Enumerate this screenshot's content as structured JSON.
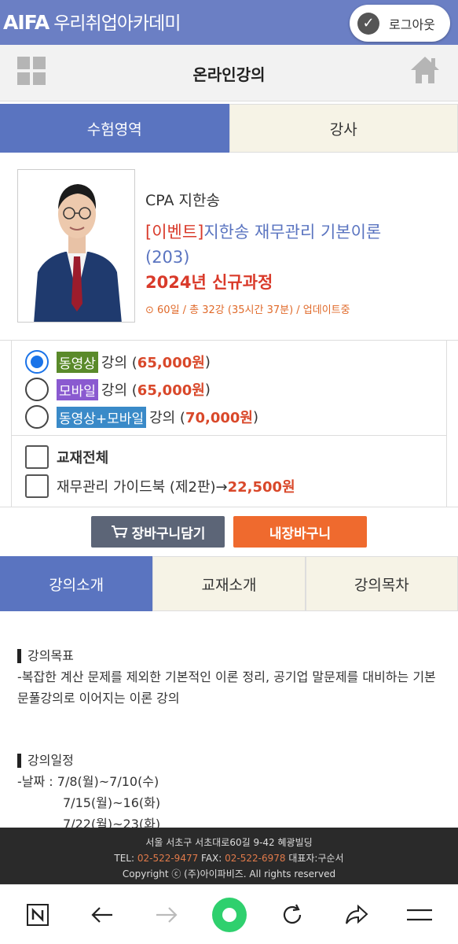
{
  "header": {
    "brand_main": "AIFA",
    "brand_sub": "우리취업아카데미",
    "logout_label": "로그아웃"
  },
  "subheader": {
    "title": "온라인강의"
  },
  "top_tabs": [
    {
      "label": "수험영역",
      "active": true
    },
    {
      "label": "강사",
      "active": false
    }
  ],
  "course": {
    "instructor": "CPA 지한송",
    "event_tag": "[이벤트]",
    "title_main": "지한송 재무관리 기본이론",
    "title_num": "(203)",
    "year_label": "2024년 신규과정",
    "meta": "⊙ 60일 / 총 32강 (35시간 37분) / 업데이트중"
  },
  "options": [
    {
      "tag": "동영상",
      "tag_color": "#5a8a2a",
      "suffix": " 강의 (",
      "price": "65,000원",
      "close": ")",
      "selected": true
    },
    {
      "tag": "모바일",
      "tag_color": "#8a5ad0",
      "suffix": " 강의 (",
      "price": "65,000원",
      "close": ")",
      "selected": false
    },
    {
      "tag": "동영상+모바일",
      "tag_color": "#3a8ac8",
      "suffix": " 강의 (",
      "price": "70,000원",
      "close": ")",
      "selected": false
    }
  ],
  "books": {
    "all_label": "교재전체",
    "item_label": "재무관리 가이드북 (제2판)→ ",
    "item_price": "22,500원"
  },
  "buttons": {
    "cart": "장바구니담기",
    "mycart": "내장바구니"
  },
  "detail_tabs": [
    {
      "label": "강의소개",
      "active": true
    },
    {
      "label": "교재소개",
      "active": false
    },
    {
      "label": "강의목차",
      "active": false
    }
  ],
  "content": {
    "goal_heading": "강의목표",
    "goal_text": "-복잡한 계산 문제를 제외한 기본적인 이론 정리, 공기업 말문제를 대비하는 기본 문풀강의로 이어지는 이론 강의",
    "schedule_heading": "강의일정",
    "schedule_line1": "-날짜 : 7/8(월)~7/10(수)",
    "schedule_line2": "7/15(월)~16(화)",
    "schedule_line3": "7/22(월)~23(화)"
  },
  "footer": {
    "address": "서울 서초구 서초대로60길 9-42 혜광빌딩",
    "tel_label": "TEL: ",
    "tel": "02-522-9477",
    "fax_label": " FAX: ",
    "fax": "02-522-6978",
    "ceo": " 대표자:구순서",
    "copyright": "Copyright ⓒ (주)아이파비즈. All rights reserved"
  },
  "colors": {
    "header_bg": "#6b7fc4",
    "accent_blue": "#5a74c0",
    "price_red": "#d9482a",
    "cart_btn": "#5c6577",
    "mycart_btn": "#ef6a2e"
  }
}
